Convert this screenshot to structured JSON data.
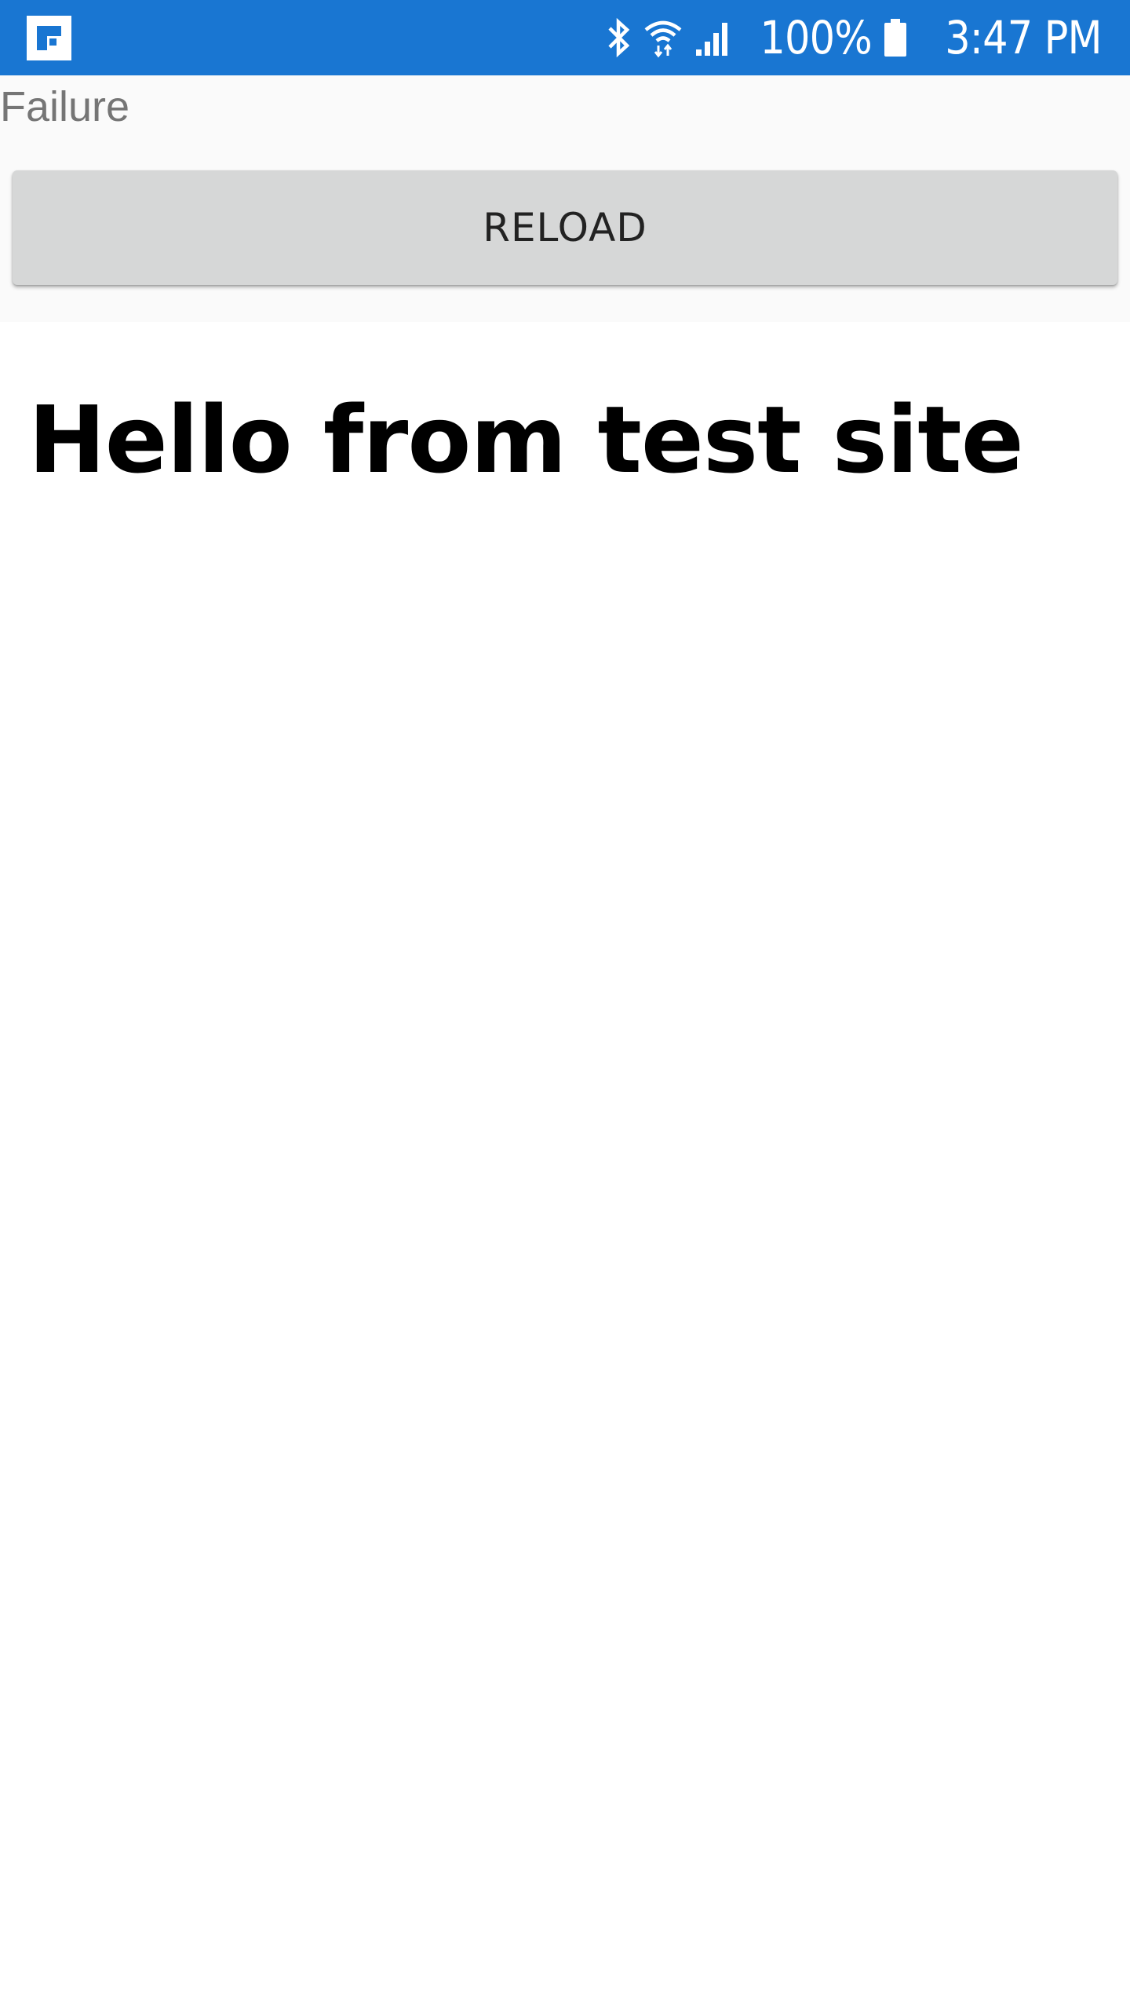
{
  "status_bar": {
    "battery_percent": "100%",
    "time": "3:47 PM",
    "background_color": "#1976d2",
    "icons": [
      "app-notification-icon",
      "bluetooth-icon",
      "wifi-icon",
      "signal-icon",
      "battery-icon"
    ]
  },
  "app": {
    "status_text": "Failure",
    "reload_label": "RELOAD"
  },
  "web": {
    "heading": "Hello from test site"
  }
}
